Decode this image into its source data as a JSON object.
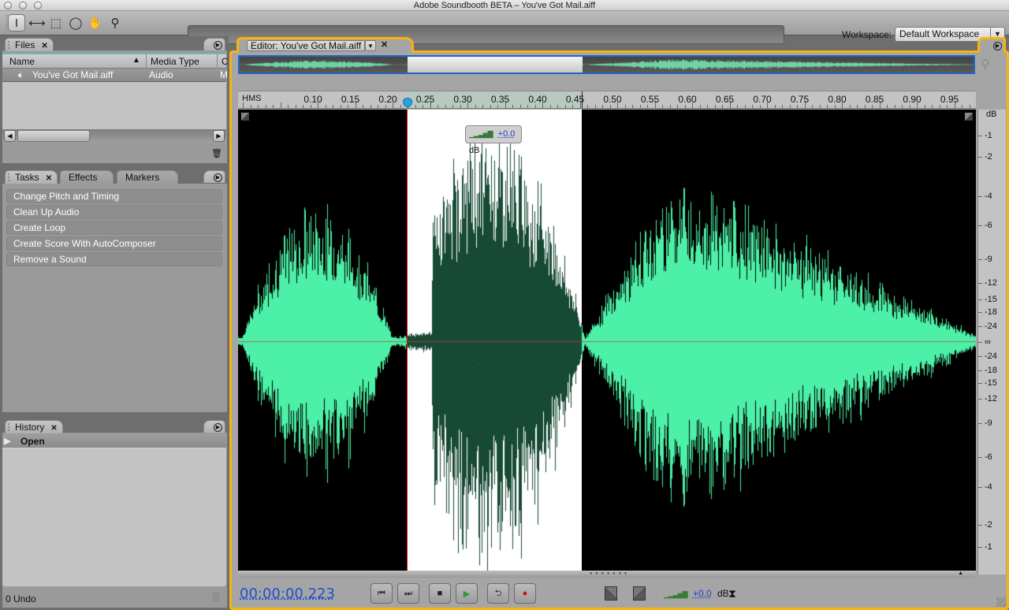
{
  "window": {
    "title": "Adobe Soundbooth BETA – You've Got Mail.aiff"
  },
  "toolbar": {
    "tools": [
      {
        "name": "time-selection-tool",
        "icon": "I-beam",
        "active": true
      },
      {
        "name": "frequency-selection-tool",
        "icon": "⟷",
        "active": false
      },
      {
        "name": "marquee-tool",
        "icon": "⬚",
        "active": false
      },
      {
        "name": "lasso-tool",
        "icon": "lasso",
        "active": false
      },
      {
        "name": "hand-tool",
        "icon": "✋",
        "active": false
      },
      {
        "name": "zoom-tool",
        "icon": "🔍",
        "active": false
      }
    ],
    "workspace_label": "Workspace:",
    "workspace_value": "Default Workspace"
  },
  "files_panel": {
    "tab": "Files",
    "columns": [
      "Name",
      "Media Type",
      "C"
    ],
    "rows": [
      {
        "name": "You've Got Mail.aiff",
        "media_type": "Audio",
        "extra": "M"
      }
    ]
  },
  "tasks_panel": {
    "tabs": [
      "Tasks",
      "Effects",
      "Markers"
    ],
    "active_tab": "Tasks",
    "items": [
      "Change Pitch and Timing",
      "Clean Up Audio",
      "Create Loop",
      "Create Score With AutoComposer",
      "Remove a Sound"
    ]
  },
  "history_panel": {
    "tab": "History",
    "items": [
      "Open"
    ],
    "undo_count": "0 Undo"
  },
  "editor": {
    "tab": "Editor: You've Got Mail.aiff",
    "ruler": {
      "unit": "HMS",
      "ticks": [
        "0.10",
        "0.15",
        "0.20",
        "0.25",
        "0.30",
        "0.35",
        "0.40",
        "0.45",
        "0.50",
        "0.55",
        "0.60",
        "0.65",
        "0.70",
        "0.75",
        "0.80",
        "0.85",
        "0.90",
        "0.95"
      ]
    },
    "selection": {
      "start_s": 0.223,
      "end_s": 0.455
    },
    "gain_hud": {
      "value": "+0.0",
      "unit": "dB"
    },
    "db_scale": {
      "header": "dB",
      "labels": [
        "-1",
        "-2",
        "-4",
        "-6",
        "-9",
        "-12",
        "-15",
        "-18",
        "-24",
        "∞",
        "-24",
        "-18",
        "-15",
        "-12",
        "-9",
        "-6",
        "-4",
        "-2",
        "-1"
      ]
    },
    "timecode": "00:00:00.223",
    "transport": [
      {
        "name": "go-to-previous-button",
        "icon": "⏮"
      },
      {
        "name": "go-to-next-button",
        "icon": "⏭"
      },
      {
        "name": "stop-button",
        "icon": "■"
      },
      {
        "name": "play-button",
        "icon": "▶"
      },
      {
        "name": "loop-button",
        "icon": "⟲"
      },
      {
        "name": "record-button",
        "icon": "●"
      }
    ],
    "bottom_gain": {
      "value": "+0.0",
      "unit": "dB"
    }
  },
  "colors": {
    "accent": "#f6b40c",
    "waveform": "#4cf0a6",
    "waveform_selected": "#174a35",
    "cursor": "#d01414",
    "overview_border": "#2166c6",
    "timecode": "#1f4fcf"
  }
}
